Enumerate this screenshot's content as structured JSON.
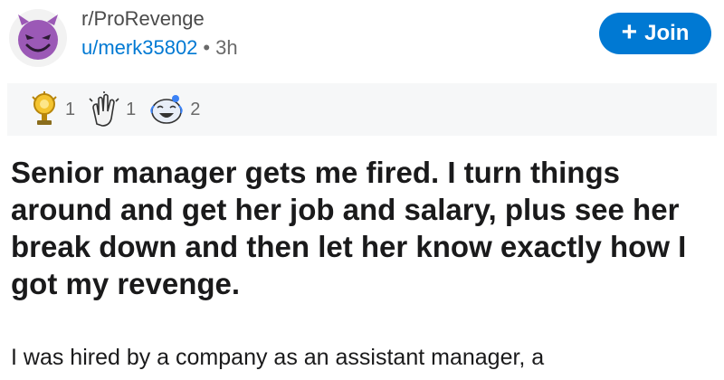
{
  "header": {
    "subreddit": "r/ProRevenge",
    "username": "u/merk35802",
    "separator": "•",
    "age": "3h",
    "avatar_icon": "devil-face-icon",
    "join_label": "Join"
  },
  "awards": [
    {
      "icon": "trophy-award-icon",
      "count": "1"
    },
    {
      "icon": "clapping-hands-award-icon",
      "count": "1"
    },
    {
      "icon": "laughing-face-award-icon",
      "count": "2"
    }
  ],
  "post": {
    "title": "Senior manager gets me fired. I turn things around and get her job and salary, plus see her break down and then let her know exactly how I got my revenge.",
    "body": "I was hired by a company as an assistant manager, a"
  },
  "colors": {
    "accent": "#0079d3",
    "avatar_purple": "#9b59b6",
    "award_bar": "#f6f7f8"
  }
}
